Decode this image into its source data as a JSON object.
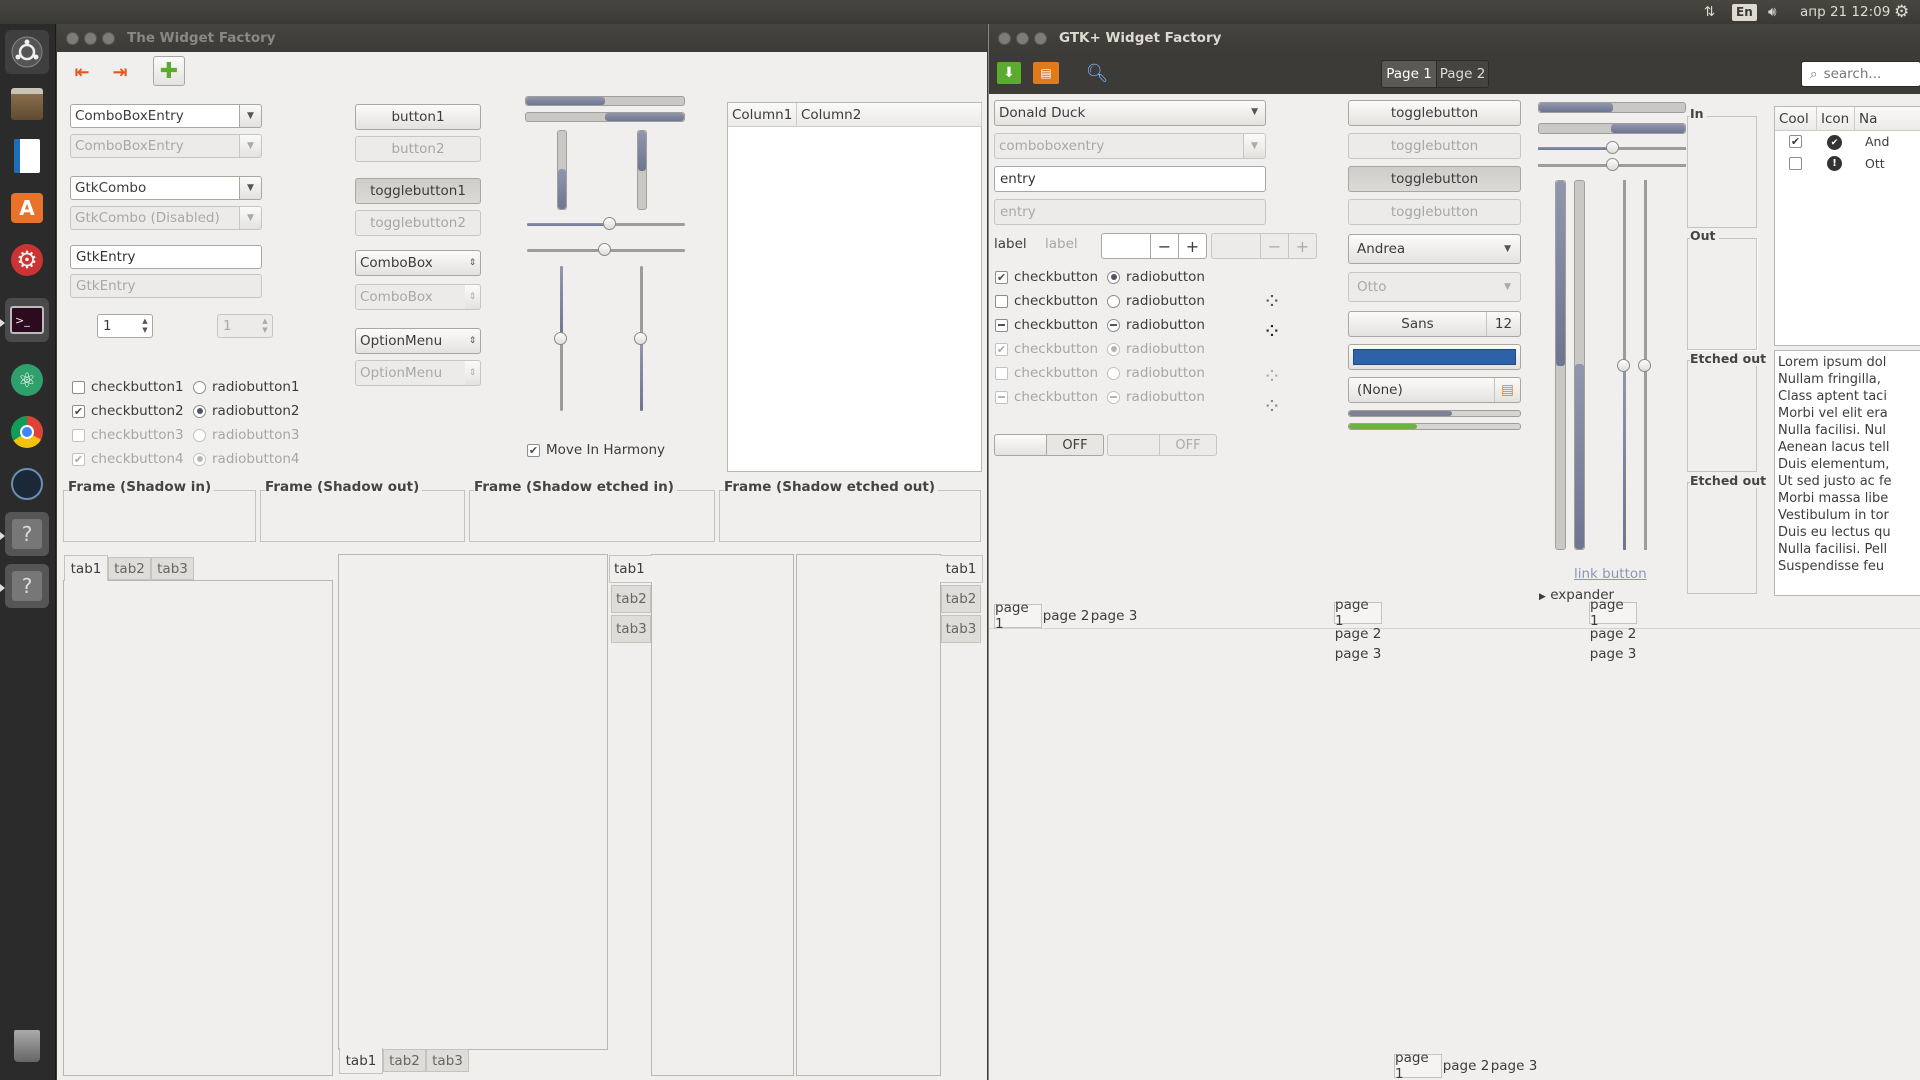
{
  "topbar": {
    "lang": "En",
    "clock": "апр 21 12:09"
  },
  "left_window": {
    "title": "The Widget Factory",
    "combo_entry": "ComboBoxEntry",
    "combo_entry_disabled": "ComboBoxEntry",
    "gtk_combo": "GtkCombo",
    "gtk_combo_disabled": "GtkCombo (Disabled)",
    "entry": "GtkEntry",
    "entry_disabled_placeholder": "GtkEntry",
    "spin_value": "1",
    "spin_disabled_value": "1",
    "checkbuttons": [
      "checkbutton1",
      "checkbutton2",
      "checkbutton3",
      "checkbutton4"
    ],
    "radiobuttons": [
      "radiobutton1",
      "radiobutton2",
      "radiobutton3",
      "radiobutton4"
    ],
    "button1": "button1",
    "button2": "button2",
    "togglebutton1": "togglebutton1",
    "togglebutton2": "togglebutton2",
    "combobox": "ComboBox",
    "combobox_disabled": "ComboBox",
    "optionmenu": "OptionMenu",
    "optionmenu_disabled": "OptionMenu",
    "move_in_harmony": "Move In Harmony",
    "columns": [
      "Column1",
      "Column2"
    ],
    "frames": [
      "Frame (Shadow in)",
      "Frame (Shadow out)",
      "Frame (Shadow etched in)",
      "Frame (Shadow etched out)"
    ],
    "tabs": [
      "tab1",
      "tab2",
      "tab3"
    ]
  },
  "right_window": {
    "title": "GTK+ Widget Factory",
    "header_pages": [
      "Page 1",
      "Page 2"
    ],
    "search_placeholder": "search...",
    "combo_name": "Donald Duck",
    "combo_disabled": "comboboxentry",
    "entry": "entry",
    "entry_disabled": "entry",
    "label": "label",
    "label_disabled": "label",
    "checkbutton": "checkbutton",
    "radiobutton": "radiobutton",
    "switch_off": "OFF",
    "togglebutton": "togglebutton",
    "combo_andrea": "Andrea",
    "combo_otto": "Otto",
    "font_name": "Sans",
    "font_size": "12",
    "color_hex": "#2d62a8",
    "file_chooser": "(None)",
    "progress1": 0.6,
    "progress2": 0.4,
    "link_button": "link button",
    "expander": "expander",
    "frame_labels": [
      "In",
      "Out",
      "Etched out",
      "Etched out"
    ],
    "tree_headers": [
      "Cool",
      "Icon",
      "Na"
    ],
    "tree_rows": [
      {
        "name": "And"
      },
      {
        "name": "Ott"
      }
    ],
    "lorem": [
      "Lorem ipsum dol",
      "Nullam fringilla,",
      "Class aptent taci",
      "Morbi vel elit era",
      "Nulla facilisi. Nul",
      "Aenean lacus tell",
      "Duis elementum,",
      "Ut sed justo ac fe",
      "Morbi massa libe",
      "Vestibulum in tor",
      "Duis eu lectus qu",
      "Nulla facilisi. Pell",
      "Suspendisse feu"
    ],
    "notebook_pages": [
      "page 1",
      "page 2",
      "page 3"
    ]
  }
}
